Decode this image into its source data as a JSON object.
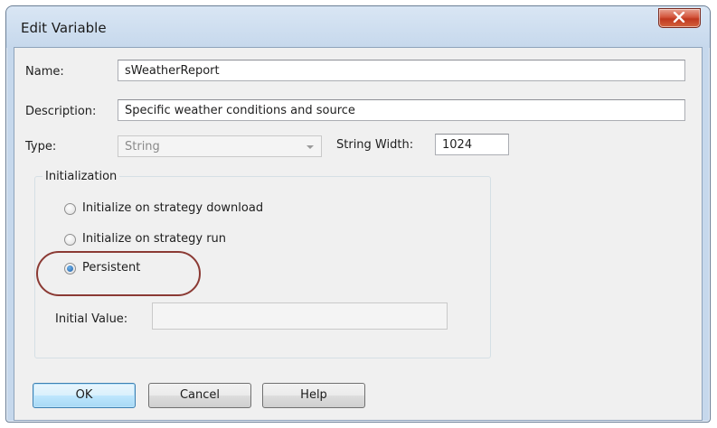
{
  "window": {
    "title": "Edit Variable"
  },
  "form": {
    "name_label": "Name:",
    "name_value": "sWeatherReport",
    "description_label": "Description:",
    "description_value": "Specific weather conditions and source",
    "type_label": "Type:",
    "type_value": "String",
    "string_width_label": "String Width:",
    "string_width_value": "1024"
  },
  "initialization": {
    "title": "Initialization",
    "options": [
      {
        "label": "Initialize on strategy download",
        "checked": false
      },
      {
        "label": "Initialize on strategy run",
        "checked": false
      },
      {
        "label": "Persistent",
        "checked": true
      }
    ],
    "initial_value_label": "Initial Value:",
    "initial_value": ""
  },
  "buttons": {
    "ok": "OK",
    "cancel": "Cancel",
    "help": "Help"
  },
  "colors": {
    "annotation_circle": "#8b3a34",
    "close_button": "#c7432a"
  }
}
